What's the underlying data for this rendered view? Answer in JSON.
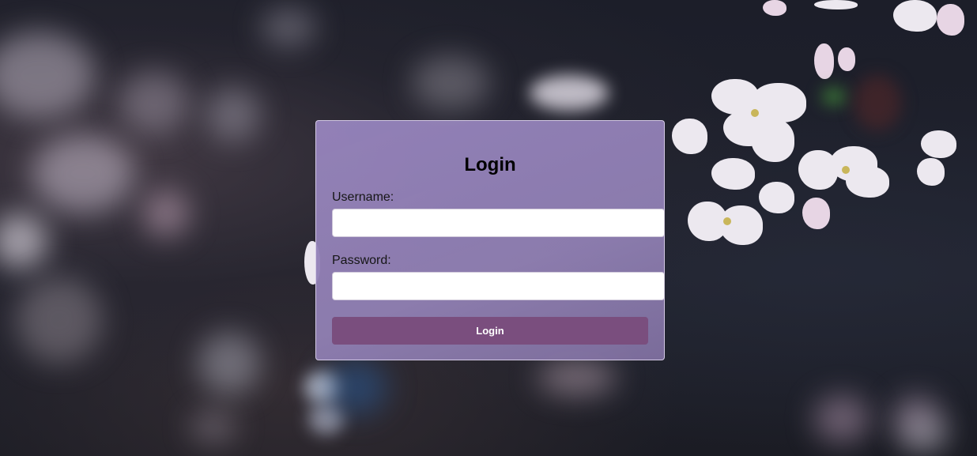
{
  "login_form": {
    "title": "Login",
    "username_label": "Username:",
    "username_value": "",
    "password_label": "Password:",
    "password_value": "",
    "submit_label": "Login"
  },
  "colors": {
    "panel": "#9684bc",
    "button": "#7a4e7e",
    "background": "#1d1f2b",
    "blossom": "#ece8ef"
  }
}
